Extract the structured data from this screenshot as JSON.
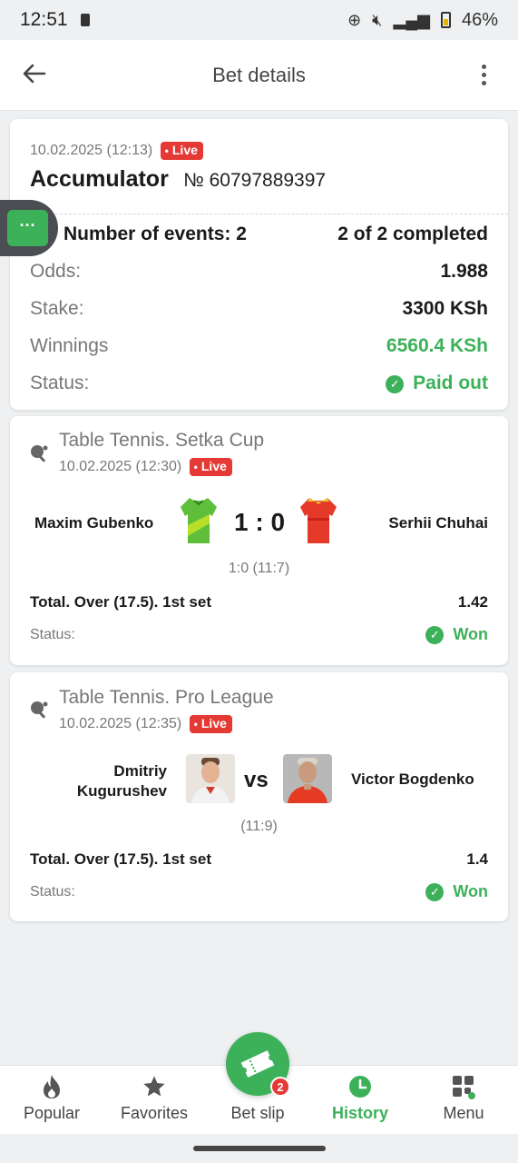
{
  "status_bar": {
    "time": "12:51",
    "battery": "46%"
  },
  "app_bar": {
    "title": "Bet details"
  },
  "summary": {
    "datetime": "10.02.2025 (12:13)",
    "live_label": "Live",
    "bet_type": "Accumulator",
    "bet_number": "№ 60797889397",
    "events_label": "Number of events: 2",
    "completed": "2 of 2 completed",
    "odds_label": "Odds:",
    "odds_value": "1.988",
    "stake_label": "Stake:",
    "stake_value": "3300 KSh",
    "winnings_label": "Winnings",
    "winnings_value": "6560.4 KSh",
    "status_label": "Status:",
    "status_value": "Paid out"
  },
  "events": [
    {
      "league": "Table Tennis. Setka Cup",
      "datetime": "10.02.2025 (12:30)",
      "live_label": "Live",
      "home": "Maxim Gubenko",
      "away": "Serhii Chuhai",
      "score": "1 : 0",
      "detail": "1:0 (11:7)",
      "market": "Total. Over (17.5). 1st set",
      "odds": "1.42",
      "status_label": "Status:",
      "status_value": "Won"
    },
    {
      "league": "Table Tennis. Pro League",
      "datetime": "10.02.2025 (12:35)",
      "live_label": "Live",
      "home_line1": "Dmitriy",
      "home_line2": "Kugurushev",
      "away": "Victor Bogdenko",
      "vs": "vs",
      "detail": "(11:9)",
      "market": "Total. Over (17.5). 1st set",
      "odds": "1.4",
      "status_label": "Status:",
      "status_value": "Won"
    }
  ],
  "bottom_nav": {
    "popular": "Popular",
    "favorites": "Favorites",
    "bet_slip": "Bet slip",
    "bet_slip_count": "2",
    "history": "History",
    "menu": "Menu"
  },
  "colors": {
    "accent": "#3db15a",
    "live": "#e53935",
    "background": "#eef0f2"
  }
}
